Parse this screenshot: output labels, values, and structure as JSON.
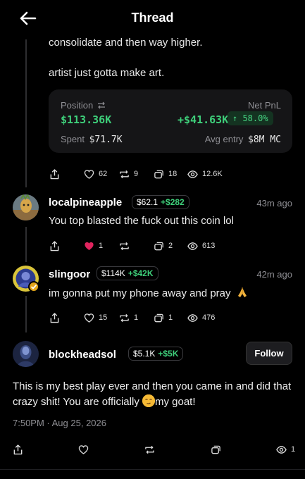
{
  "header": {
    "title": "Thread"
  },
  "parent_post": {
    "lines": [
      "consolidate and then way higher.",
      "artist just gotta make art."
    ],
    "position": {
      "position_label": "Position",
      "position_value": "$113.36K",
      "netpnl_label": "Net PnL",
      "netpnl_value": "+$41.63K",
      "pct": "58.0%",
      "spent_label": "Spent",
      "spent_value": "$71.7K",
      "avg_entry_label": "Avg entry",
      "avg_entry_value": "$8M MC"
    },
    "actions": {
      "likes": "62",
      "reposts": "9",
      "quotes": "18",
      "views": "12.6K"
    }
  },
  "replies": [
    {
      "username": "localpineapple",
      "badge_value": "$62.1",
      "badge_gain": "+$282",
      "time": "43m ago",
      "text": "You top blasted the fuck out this coin lol",
      "actions": {
        "likes": "1",
        "reposts": "",
        "quotes": "2",
        "views": "613"
      }
    },
    {
      "username": "slingoor",
      "badge_value": "$114K",
      "badge_gain": "+$42K",
      "time": "42m ago",
      "text": "im gonna put my phone away and pray",
      "actions": {
        "likes": "15",
        "reposts": "1",
        "quotes": "1",
        "views": "476"
      }
    }
  ],
  "main_post": {
    "username": "blockheadsol",
    "badge_value": "$5.1K",
    "badge_gain": "+$5K",
    "follow_label": "Follow",
    "text_before": "This is my best play ever and then you came in and did that crazy shit! You are officially ",
    "text_after": "my goat!",
    "timestamp": "7:50PM · Aug 25, 2026",
    "views": "1"
  },
  "colors": {
    "accent_green": "#3ecf7a",
    "like_red": "#e0245e",
    "background": "#000000"
  }
}
